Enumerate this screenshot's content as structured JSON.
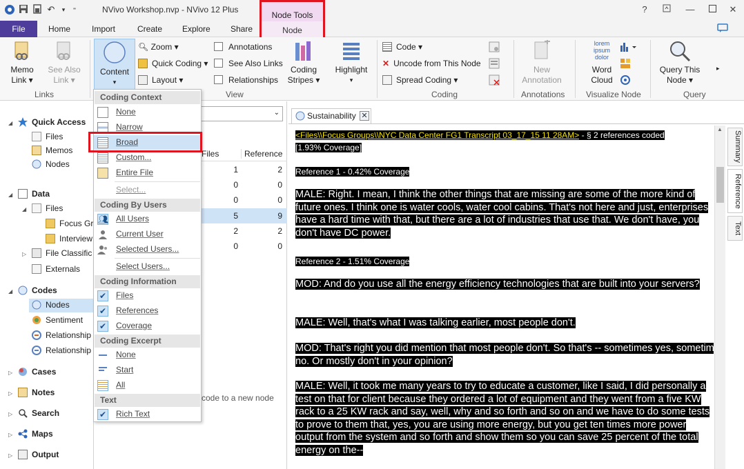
{
  "window": {
    "title": "NVivo Workshop.nvp - NVivo 12 Plus",
    "context_group": "Node Tools",
    "context_tab": "Node",
    "help": "?",
    "minimize": "—",
    "close": "✕"
  },
  "tabs": [
    "File",
    "Home",
    "Import",
    "Create",
    "Explore",
    "Share"
  ],
  "ribbon": {
    "links": {
      "memo_link": "Memo",
      "memo_link2": "Link",
      "see_also": "See Also",
      "see_also2": "Link",
      "label": "Links"
    },
    "view": {
      "content": "Content",
      "zoom": "Zoom",
      "quick_coding": "Quick Coding",
      "layout": "Layout",
      "annotations": "Annotations",
      "see_also_links": "See Also Links",
      "relationships": "Relationships",
      "coding_stripes": "Coding",
      "coding_stripes2": "Stripes",
      "highlight": "Highlight",
      "label": "View"
    },
    "coding": {
      "code": "Code",
      "uncode": "Uncode from This Node",
      "spread": "Spread Coding",
      "label": "Coding"
    },
    "annotations": {
      "new": "New",
      "new2": "Annotation",
      "label": "Annotations"
    },
    "visualize": {
      "word_cloud": "Word",
      "word_cloud2": "Cloud",
      "label": "Visualize Node",
      "cloud_text": "lorem ipsum dolor"
    },
    "query": {
      "query_node": "Query This",
      "query_node2": "Node",
      "label": "Query"
    }
  },
  "nav": {
    "quick_access": "Quick Access",
    "qa_items": [
      "Files",
      "Memos",
      "Nodes"
    ],
    "data": "Data",
    "data_files": "Files",
    "data_sub": [
      "Focus Gr",
      "Interview"
    ],
    "file_classific": "File Classific",
    "externals": "Externals",
    "codes": "Codes",
    "codes_items": [
      "Nodes",
      "Sentiment",
      "Relationship",
      "Relationship"
    ],
    "cases": "Cases",
    "notes": "Notes",
    "search": "Search",
    "maps": "Maps",
    "output": "Output"
  },
  "list": {
    "col_files": "Files",
    "col_refs": "Reference",
    "rows": [
      {
        "files": "1",
        "refs": "2"
      },
      {
        "files": "0",
        "refs": "0"
      },
      {
        "files": "0",
        "refs": "0"
      },
      {
        "files": "5",
        "refs": "9"
      },
      {
        "files": "2",
        "refs": "2"
      },
      {
        "files": "0",
        "refs": "0"
      }
    ],
    "hint": "code to a new node"
  },
  "menu": {
    "coding_context": "Coding Context",
    "cc_items": [
      "None",
      "Narrow",
      "Broad",
      "Custom...",
      "Entire File",
      "Select..."
    ],
    "coding_by_users": "Coding By Users",
    "cbu_items": [
      "All Users",
      "Current User",
      "Selected Users...",
      "Select Users..."
    ],
    "coding_information": "Coding Information",
    "ci_items": [
      "Files",
      "References",
      "Coverage"
    ],
    "coding_excerpt": "Coding Excerpt",
    "ce_items": [
      "None",
      "Start",
      "All"
    ],
    "text": "Text",
    "text_items": [
      "Rich Text"
    ]
  },
  "detail": {
    "tab": "Sustainability",
    "side_tabs": [
      "Summary",
      "Reference",
      "Text"
    ],
    "file_link": "<Files\\\\Focus Groups\\\\NYC Data Center FG1 Transcript 03_17_15 11 28AM>",
    "refs_coded": " - § 2 references coded",
    "coverage": "[1.93% Coverage]",
    "ref1": "Reference 1 - 0.42% Coverage",
    "ref2": "Reference 2 - 1.51% Coverage",
    "p1": "MALE:  Right.  I mean, I think the other things that are missing are some of the more kind of future ones.  I think one is water cools, water cool cabins.  That's not here and just, enterprises have a hard time with that, but there are a lot of industries that use that.  We don't have, you don't have DC power.",
    "p2": "MOD:  And do you use all the energy efficiency technologies that are built into your servers?",
    "p3": "MALE:  Well, that's what I was talking earlier, most people don't.",
    "p4": "MOD:  That's right you did mention that most people don't.  So that's -- sometimes yes, sometimes no.  Or mostly don't in your opinion?",
    "p5": "MALE:  Well, it took me many years to try to educate a customer, like I said, I did personally a test on that for client because they ordered a lot of equipment and they went from a five KW rack to a 25 KW rack and say, well, why and so forth and so on and we have to do some tests to prove to them that, yes, you are using more energy, but you get ten times more power output from the system and so forth and show them so you can save 25 percent of the total energy on the--"
  }
}
